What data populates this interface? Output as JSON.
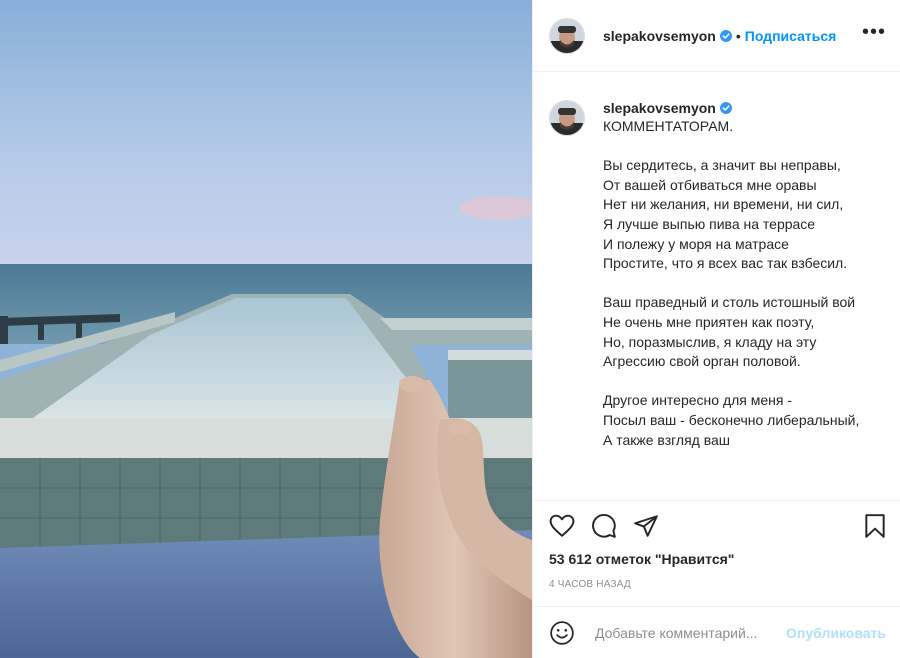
{
  "post": {
    "image_alt": "Feet on a sunbed overlooking an infinity pool and the sea",
    "username": "slepakovsemyon",
    "verified": true,
    "follow_label": "Подписаться",
    "dot": "•",
    "more_label": "•••",
    "caption_title": "КОММЕНТАТОРАМ.",
    "caption_text": "Вы сердитесь, а значит вы неправы,\nОт вашей отбиваться мне оравы\nНет ни желания, ни времени, ни сил,\nЯ лучше выпью пива на террасе\nИ полежу у моря на матрасе\nПростите, что я всех вас так взбесил.\n\nВаш праведный и столь истошный вой\nНе очень мне приятен как поэту,\nНо, поразмыслив, я кладу на эту\nАгрессию свой орган половой.\n\nДругое интересно для меня -\nПосыл ваш - бесконечно либеральный,\nА также взгляд ваш",
    "likes": "53 612 отметок \"Нравится\"",
    "timestamp": "4 часов назад",
    "comment_placeholder": "Добавьте комментарий...",
    "publish_label": "Опубликовать"
  },
  "icons": {
    "like": "heart-icon",
    "comment": "comment-icon",
    "share": "paper-plane-icon",
    "save": "bookmark-icon",
    "emoji": "smiley-icon",
    "verified": "verified-badge-icon"
  },
  "colors": {
    "accent": "#0095f6",
    "publish_disabled": "#b2dffc",
    "verified": "#3897f0",
    "text": "#262626",
    "muted": "#8e8e8e",
    "border": "#efefef"
  }
}
